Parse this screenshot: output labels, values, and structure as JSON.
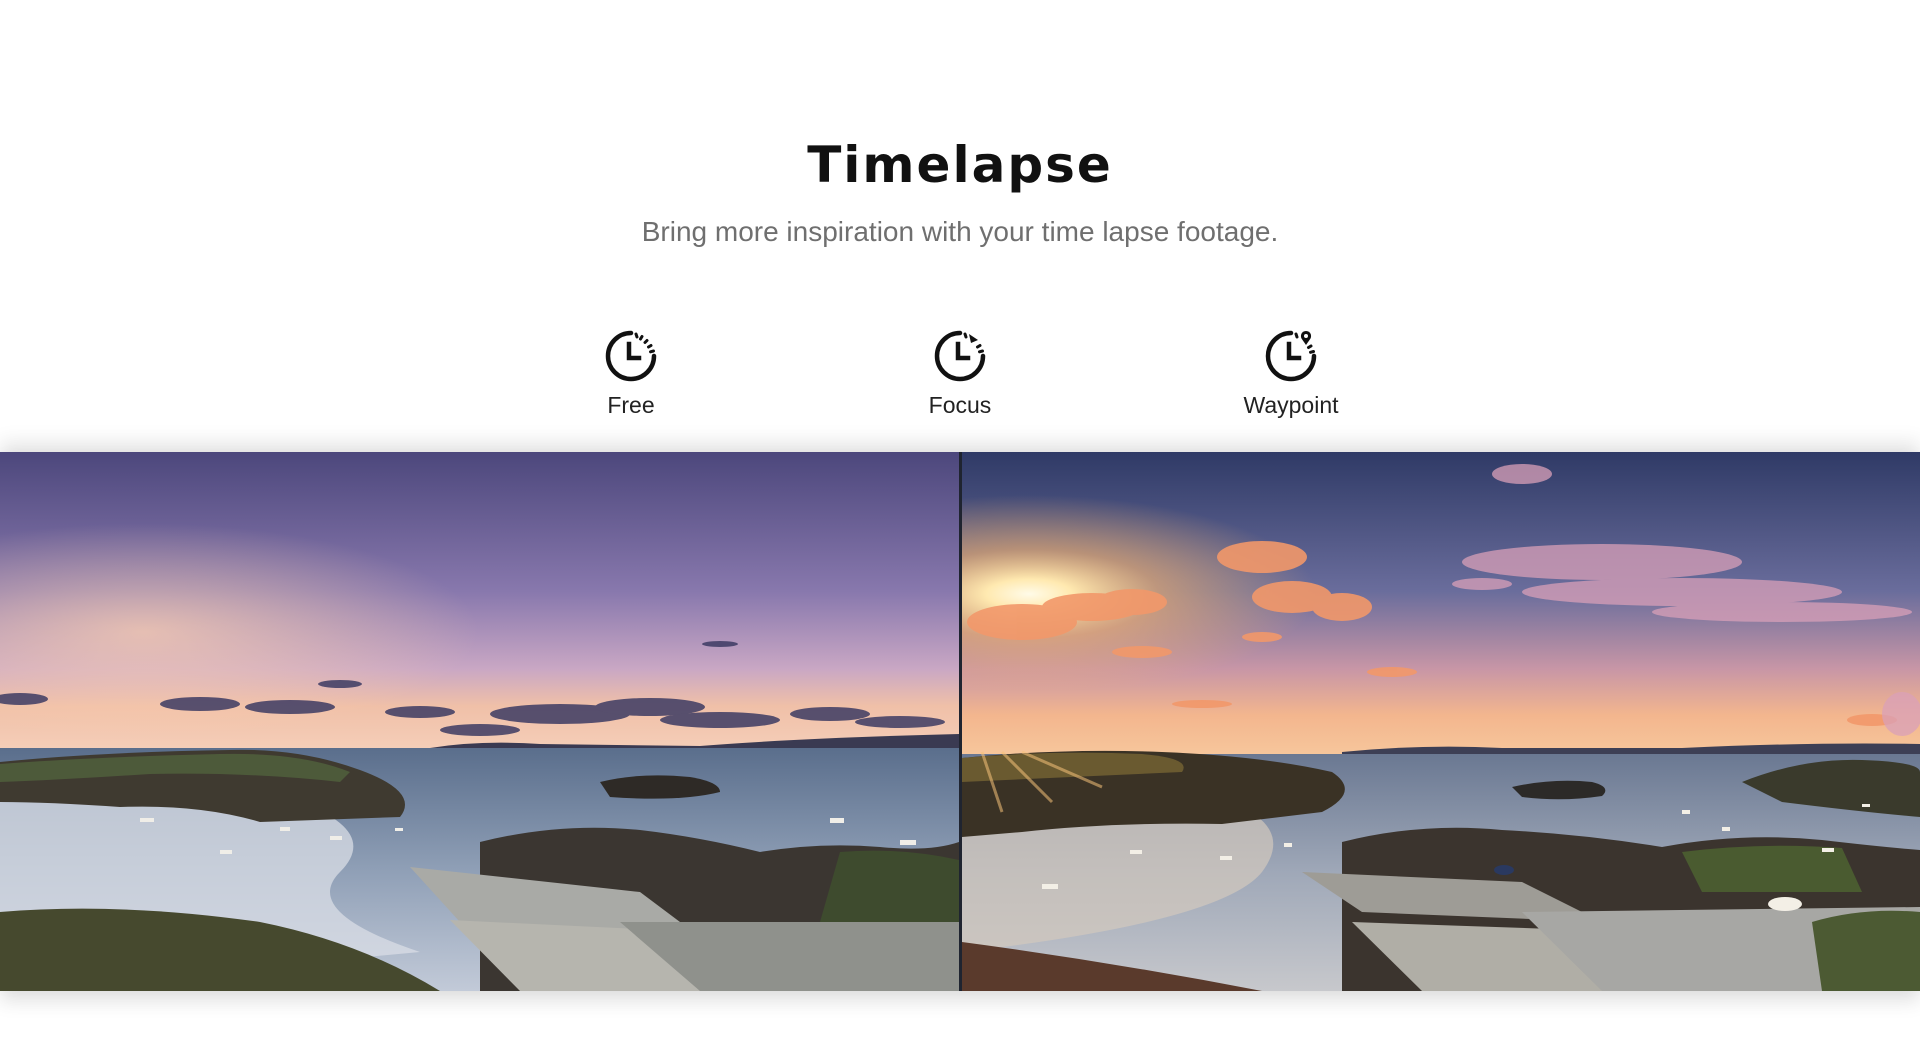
{
  "section": {
    "title": "Timelapse",
    "subtitle": "Bring more inspiration with your time lapse footage."
  },
  "modes": [
    {
      "label": "Free",
      "icon": "clock-free-icon"
    },
    {
      "label": "Focus",
      "icon": "clock-focus-icon"
    },
    {
      "label": "Waypoint",
      "icon": "clock-waypoint-icon"
    }
  ],
  "colors": {
    "title": "#111111",
    "subtitle": "#6f6f6f",
    "icon": "#111111"
  }
}
